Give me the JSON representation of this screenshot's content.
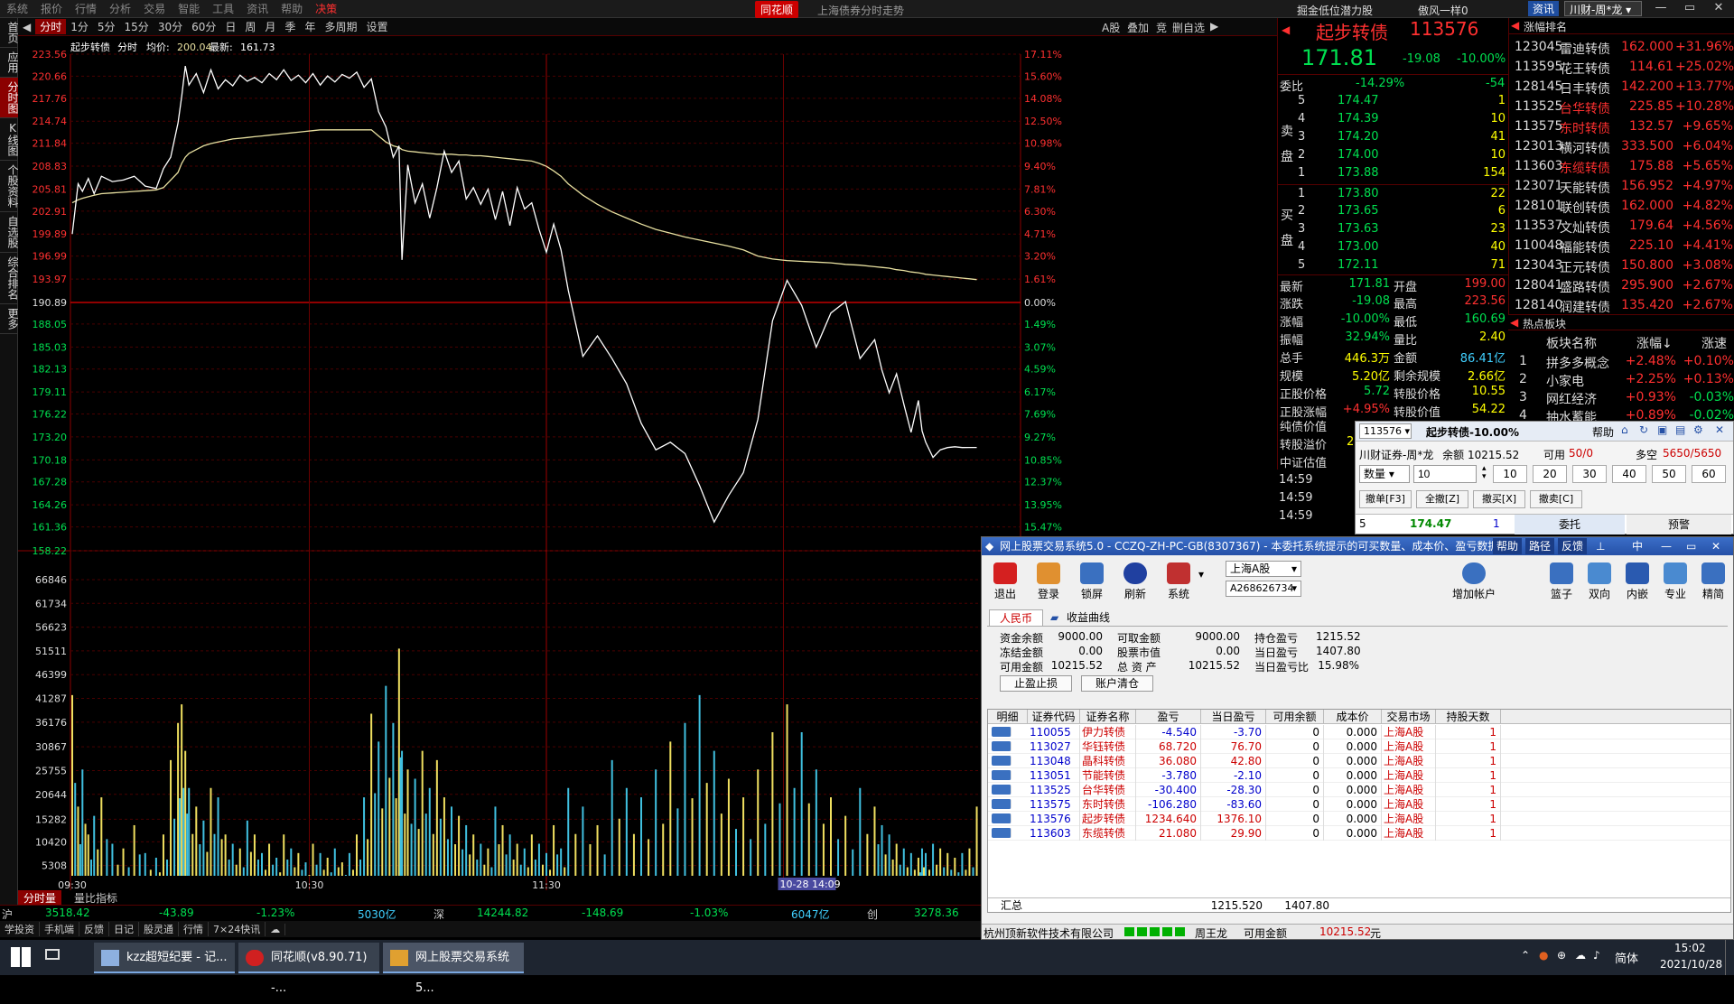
{
  "menu": {
    "items": [
      "系统",
      "报价",
      "行情",
      "分析",
      "交易",
      "智能",
      "工具",
      "资讯",
      "帮助",
      "决策"
    ],
    "logo": "同花顺",
    "window_title": "上海债券分时走势",
    "promo1": "掘金低位潜力股",
    "promo2": "傲风一样0",
    "news_btn": "资讯",
    "account_select": "川财-周*龙"
  },
  "leftbar": [
    "首页",
    "应用",
    "分时图",
    "K线图",
    "个股资料",
    "自选股",
    "综合排名",
    "更多"
  ],
  "toolbar": {
    "periods": [
      "分时",
      "1分",
      "5分",
      "15分",
      "30分",
      "60分",
      "日",
      "周",
      "月",
      "季",
      "年",
      "多周期",
      "设置"
    ],
    "right": [
      "A股",
      "叠加",
      "竞",
      "删自选"
    ]
  },
  "chart": {
    "header_name": "起步转债",
    "header_mode": "分时",
    "header_avg_label": "均价:",
    "header_avg": "200.04",
    "header_last_label": "最新:",
    "header_last": "161.73",
    "prev_close": "190.89",
    "price_ticks_up": [
      "223.56",
      "220.66",
      "217.76",
      "214.74",
      "211.84",
      "208.83",
      "205.81",
      "202.91",
      "199.89",
      "196.99",
      "193.97"
    ],
    "price_ticks_down": [
      "188.05",
      "185.03",
      "182.13",
      "179.11",
      "176.22",
      "173.20",
      "170.18",
      "167.28",
      "164.26",
      "161.36",
      "158.22"
    ],
    "pct_ticks_up": [
      "17.11%",
      "15.60%",
      "14.08%",
      "12.50%",
      "10.98%",
      "9.40%",
      "7.81%",
      "6.30%",
      "4.71%",
      "3.20%",
      "1.61%"
    ],
    "pct_zero": "0.00%",
    "pct_ticks_down": [
      "1.49%",
      "3.07%",
      "4.59%",
      "6.17%",
      "7.69%",
      "9.27%",
      "10.85%",
      "12.37%",
      "13.95%",
      "15.47%"
    ],
    "vol_ticks": [
      "66846",
      "61734",
      "56623",
      "51511",
      "46399",
      "41287",
      "36176",
      "30867",
      "25755",
      "20644",
      "15282",
      "10420",
      "5308"
    ],
    "time_labels": [
      "09:30",
      "10:30",
      "11:30"
    ],
    "date_label": "10-28 14:09",
    "tabs": [
      "分时量",
      "量比指标"
    ]
  },
  "index_bar": {
    "sh_label": "沪",
    "sh_value": "3518.42",
    "sh_change": "-43.89",
    "sh_pct": "-1.23%",
    "sh_amount": "5030亿",
    "sz_label": "深",
    "sz_value": "14244.82",
    "sz_change": "-148.69",
    "sz_pct": "-1.03%",
    "sz_amount": "6047亿",
    "cy_label": "创",
    "cy_value": "3278.36"
  },
  "quickbar": [
    "学投资",
    "手机端",
    "反馈",
    "日记",
    "股灵通",
    "行情",
    "7×24快讯"
  ],
  "quote": {
    "name": "起步转债",
    "code": "113576",
    "price": "171.81",
    "change": "-19.08",
    "pct": "-10.00%",
    "weibi_label": "委比",
    "weibi": "-14.29%",
    "weicha": "-54",
    "sell_label": "卖盘",
    "buy_label": "买盘",
    "asks": [
      {
        "lv": "5",
        "p": "174.47",
        "v": "1"
      },
      {
        "lv": "4",
        "p": "174.39",
        "v": "10"
      },
      {
        "lv": "3",
        "p": "174.20",
        "v": "41"
      },
      {
        "lv": "2",
        "p": "174.00",
        "v": "10"
      },
      {
        "lv": "1",
        "p": "173.88",
        "v": "154"
      }
    ],
    "bids": [
      {
        "lv": "1",
        "p": "173.80",
        "v": "22"
      },
      {
        "lv": "2",
        "p": "173.65",
        "v": "6"
      },
      {
        "lv": "3",
        "p": "173.63",
        "v": "23"
      },
      {
        "lv": "4",
        "p": "173.00",
        "v": "40"
      },
      {
        "lv": "5",
        "p": "172.11",
        "v": "71"
      }
    ],
    "stats": [
      {
        "l1": "最新",
        "v1": "171.81",
        "l2": "开盘",
        "v2": "199.00"
      },
      {
        "l1": "涨跌",
        "v1": "-19.08",
        "l2": "最高",
        "v2": "223.56"
      },
      {
        "l1": "涨幅",
        "v1": "-10.00%",
        "l2": "最低",
        "v2": "160.69"
      },
      {
        "l1": "振幅",
        "v1": "32.94%",
        "l2": "量比",
        "v2": "2.40"
      },
      {
        "l1": "总手",
        "v1": "446.3万",
        "l2": "金额",
        "v2": "86.41亿"
      },
      {
        "l1": "规模",
        "v1": "5.20亿",
        "l2": "剩余规模",
        "v2": "2.66亿"
      },
      {
        "l1": "正股价格",
        "v1": "5.72",
        "l2": "转股价格",
        "v2": "10.55"
      },
      {
        "l1": "正股涨幅",
        "v1": "+4.95%",
        "l2": "转股价值",
        "v2": "54.22"
      }
    ],
    "extra": [
      "纯债价值",
      "转股溢价",
      "中证估值"
    ],
    "extra_val": "2",
    "ticks": [
      "14:59",
      "14:59",
      "14:59"
    ]
  },
  "ranking": {
    "title": "涨幅排名",
    "rows": [
      {
        "code": "123045",
        "name": "雷迪转债",
        "price": "162.000",
        "pct": "+31.96%"
      },
      {
        "code": "113595",
        "name": "花王转债",
        "price": "114.61",
        "pct": "+25.02%"
      },
      {
        "code": "128145",
        "name": "日丰转债",
        "price": "142.200",
        "pct": "+13.77%"
      },
      {
        "code": "113525",
        "name": "台华转债",
        "price": "225.85",
        "pct": "+10.28%"
      },
      {
        "code": "113575",
        "name": "东时转债",
        "price": "132.57",
        "pct": "+9.65%"
      },
      {
        "code": "123013",
        "name": "横河转债",
        "price": "333.500",
        "pct": "+6.04%"
      },
      {
        "code": "113603",
        "name": "东缆转债",
        "price": "175.88",
        "pct": "+5.65%"
      },
      {
        "code": "123071",
        "name": "天能转债",
        "price": "156.952",
        "pct": "+4.97%"
      },
      {
        "code": "128101",
        "name": "联创转债",
        "price": "162.000",
        "pct": "+4.82%"
      },
      {
        "code": "113537",
        "name": "文灿转债",
        "price": "179.64",
        "pct": "+4.56%"
      },
      {
        "code": "110048",
        "name": "福能转债",
        "price": "225.10",
        "pct": "+4.41%"
      },
      {
        "code": "123043",
        "name": "正元转债",
        "price": "150.800",
        "pct": "+3.08%"
      },
      {
        "code": "128041",
        "name": "盛路转债",
        "price": "295.900",
        "pct": "+2.67%"
      },
      {
        "code": "128140",
        "name": "润建转债",
        "price": "135.420",
        "pct": "+2.67%"
      }
    ]
  },
  "board": {
    "title": "热点板块",
    "headers": [
      "板块名称",
      "涨幅↓",
      "涨速"
    ],
    "rows": [
      {
        "n": "1",
        "name": "拼多多概念",
        "pct": "+2.48%",
        "spd": "+0.10%"
      },
      {
        "n": "2",
        "name": "小家电",
        "pct": "+2.25%",
        "spd": "+0.13%"
      },
      {
        "n": "3",
        "name": "网红经济",
        "pct": "+0.93%",
        "spd": "-0.03%"
      },
      {
        "n": "4",
        "name": "抽水蓄能",
        "pct": "+0.89%",
        "spd": "-0.02%"
      }
    ]
  },
  "order": {
    "code": "113576",
    "title": "起步转债-10.00%",
    "help": "帮助",
    "account": "川财证券-周*龙",
    "balance_label": "余额",
    "balance": "10215.52",
    "avail_label": "可用",
    "avail": "50/0",
    "dk_label": "多空",
    "dk": "5650/5650",
    "qty_label": "数量",
    "qty_value": "10",
    "qty_btns": [
      "10",
      "20",
      "30",
      "40",
      "50",
      "60"
    ],
    "actions": [
      "撤单[F3]",
      "全撤[Z]",
      "撤买[X]",
      "撤卖[C]"
    ],
    "level": "5",
    "level_price": "174.47",
    "level_vol": "1",
    "tab1": "委托",
    "tab2": "预警"
  },
  "trade": {
    "title": "网上股票交易系统5.0 - CCZQ-ZH-PC-GB(8307367) - 本委托系统提示的可买数量、成本价、盈亏数据仅供参考",
    "title_btns": [
      "帮助",
      "路径",
      "反馈"
    ],
    "lang": "中",
    "toolbar": [
      "退出",
      "登录",
      "锁屏",
      "刷新",
      "系统"
    ],
    "market_select": "上海A股",
    "account_select": "A268626734",
    "add_account": "增加帐户",
    "right_tools": [
      "篮子",
      "双向",
      "内嵌",
      "专业",
      "精简"
    ],
    "tab_rmb": "人民币",
    "tab_curve": "收益曲线",
    "summary": [
      {
        "l": "资金余额",
        "v": "9000.00",
        "l2": "可取金额",
        "v2": "9000.00",
        "l3": "持仓盈亏",
        "v3": "1215.52"
      },
      {
        "l": "冻结金额",
        "v": "0.00",
        "l2": "股票市值",
        "v2": "0.00",
        "l3": "当日盈亏",
        "v3": "1407.80"
      },
      {
        "l": "可用金额",
        "v": "10215.52",
        "l2": "总 资 产",
        "v2": "10215.52",
        "l3": "当日盈亏比",
        "v3": "15.98%"
      }
    ],
    "btn_stop": "止盈止损",
    "btn_clear": "账户清仓",
    "columns": [
      "明细",
      "证券代码",
      "证券名称",
      "盈亏",
      "当日盈亏",
      "可用余额",
      "成本价",
      "交易市场",
      "持股天数"
    ],
    "rows": [
      {
        "code": "110055",
        "name": "伊力转债",
        "pl": "-4.540",
        "dpl": "-3.70",
        "avail": "0",
        "cost": "0.000",
        "mkt": "上海A股",
        "days": "1"
      },
      {
        "code": "113027",
        "name": "华钰转债",
        "pl": "68.720",
        "dpl": "76.70",
        "avail": "0",
        "cost": "0.000",
        "mkt": "上海A股",
        "days": "1"
      },
      {
        "code": "113048",
        "name": "晶科转债",
        "pl": "36.080",
        "dpl": "42.80",
        "avail": "0",
        "cost": "0.000",
        "mkt": "上海A股",
        "days": "1"
      },
      {
        "code": "113051",
        "name": "节能转债",
        "pl": "-3.780",
        "dpl": "-2.10",
        "avail": "0",
        "cost": "0.000",
        "mkt": "上海A股",
        "days": "1"
      },
      {
        "code": "113525",
        "name": "台华转债",
        "pl": "-30.400",
        "dpl": "-28.30",
        "avail": "0",
        "cost": "0.000",
        "mkt": "上海A股",
        "days": "1"
      },
      {
        "code": "113575",
        "name": "东时转债",
        "pl": "-106.280",
        "dpl": "-83.60",
        "avail": "0",
        "cost": "0.000",
        "mkt": "上海A股",
        "days": "1"
      },
      {
        "code": "113576",
        "name": "起步转债",
        "pl": "1234.640",
        "dpl": "1376.10",
        "avail": "0",
        "cost": "0.000",
        "mkt": "上海A股",
        "days": "1"
      },
      {
        "code": "113603",
        "name": "东缆转债",
        "pl": "21.080",
        "dpl": "29.90",
        "avail": "0",
        "cost": "0.000",
        "mkt": "上海A股",
        "days": "1"
      }
    ],
    "total_label": "汇总",
    "total_pl": "1215.520",
    "total_dpl": "1407.80",
    "status_company": "杭州顶新软件技术有限公司",
    "status_user": "周王龙",
    "status_avail_label": "可用金额",
    "status_avail": "10215.52",
    "status_unit": "元"
  },
  "taskbar": {
    "tasks": [
      "kzz超短纪要 - 记...",
      "同花顺(v8.90.71) -...",
      "网上股票交易系统5..."
    ],
    "lang": "简体",
    "time": "15:02",
    "date": "2021/10/28"
  },
  "colors": {
    "up": "#ff3030",
    "down": "#00e050",
    "price_line": "#ffffff",
    "avg_line": "#e8e0a0",
    "grid": "#6a0000"
  },
  "chart_data": {
    "type": "line",
    "title": "起步转债 分时",
    "prev_close": 190.89,
    "ylim": [
      158.22,
      223.56
    ],
    "price_x": [
      0,
      8,
      14,
      22,
      30,
      40,
      55,
      70,
      85,
      100,
      115,
      125,
      135,
      145,
      150,
      155,
      160,
      170,
      180,
      190,
      200,
      210,
      220,
      230,
      240,
      250,
      260,
      270,
      280,
      290,
      300,
      310,
      320,
      330,
      340,
      350,
      360,
      370,
      380,
      390,
      400,
      410,
      420,
      430,
      440,
      448,
      452,
      460,
      470,
      480,
      490,
      500,
      510,
      520,
      530,
      540,
      550,
      560,
      570,
      580,
      590,
      600,
      610,
      620,
      630,
      640,
      650,
      660,
      670,
      680,
      700,
      720,
      740,
      760,
      780,
      800,
      820,
      840,
      860,
      880,
      900,
      920,
      940,
      960,
      980,
      1000,
      1020,
      1040,
      1060,
      1080,
      1100,
      1110,
      1120,
      1130,
      1140,
      1150,
      1160,
      1165,
      1170,
      1180,
      1190,
      1200,
      1210,
      1220,
      1230,
      1240
    ],
    "price": [
      199.9,
      206.5,
      205.5,
      207.2,
      205.2,
      207.5,
      206.8,
      207.0,
      207.5,
      206.2,
      205.9,
      208.5,
      210.0,
      214.5,
      218.0,
      222.0,
      219.5,
      221.0,
      218.5,
      221.5,
      219.0,
      220.2,
      219.4,
      220.8,
      220.0,
      220.5,
      219.8,
      221.0,
      220.2,
      221.5,
      220.1,
      220.8,
      219.8,
      221.0,
      219.5,
      220.7,
      219.9,
      220.9,
      220.4,
      221.2,
      219.2,
      220.3,
      216.0,
      214.0,
      210.0,
      211.5,
      196.5,
      209.0,
      204.0,
      206.5,
      202.0,
      206.0,
      210.8,
      208.0,
      209.5,
      204.5,
      206.0,
      203.8,
      205.8,
      201.8,
      205.5,
      201.0,
      206.0,
      203.2,
      204.0,
      200.5,
      197.5,
      201.2,
      197.8,
      192.5,
      183.8,
      186.5,
      183.5,
      180.2,
      175.0,
      171.5,
      172.5,
      171.0,
      166.8,
      162.0,
      165.5,
      168.5,
      175.5,
      188.5,
      193.8,
      190.5,
      185.0,
      189.5,
      191.0,
      183.5,
      186.0,
      182.0,
      179.0,
      181.5,
      177.5,
      173.8,
      178.0,
      174.0,
      172.5,
      170.5,
      171.5,
      171.8,
      171.9,
      171.8,
      171.81,
      171.81
    ],
    "avg": [
      204.0,
      204.4,
      204.6,
      204.8,
      205.0,
      205.2,
      205.3,
      205.4,
      205.5,
      205.6,
      205.7,
      206.0,
      207.0,
      208.0,
      209.2,
      210.0,
      210.5,
      211.0,
      211.5,
      211.8,
      212.0,
      212.2,
      212.4,
      212.5,
      212.6,
      212.7,
      212.8,
      212.9,
      213.0,
      213.1,
      213.2,
      213.3,
      213.4,
      213.5,
      213.6,
      213.6,
      213.6,
      213.6,
      213.6,
      213.6,
      213.6,
      213.6,
      212.8,
      212.0,
      211.5,
      211.3,
      211.0,
      210.8,
      210.7,
      210.6,
      210.5,
      210.4,
      210.4,
      210.4,
      210.3,
      210.3,
      210.2,
      210.2,
      210.1,
      210.0,
      209.9,
      209.8,
      209.7,
      209.6,
      209.5,
      209.2,
      208.8,
      208.2,
      207.5,
      206.5,
      205.0,
      203.8,
      202.8,
      202.0,
      201.2,
      200.5,
      200.0,
      199.5,
      199.1,
      198.7,
      198.3,
      197.8,
      197.0,
      196.6,
      196.4,
      196.3,
      196.2,
      196.1,
      195.9,
      195.8,
      195.6,
      195.5,
      195.4,
      195.2,
      195.1,
      194.9,
      194.8,
      194.7,
      194.6,
      194.5,
      194.4,
      194.3,
      194.2,
      194.1,
      194.0,
      193.9
    ],
    "volume": [
      42000,
      18000,
      26000,
      12000,
      16000,
      20000,
      10000,
      9000,
      14000,
      8000,
      7000,
      12000,
      28000,
      36000,
      40000,
      30000,
      22000,
      18000,
      15000,
      22000,
      20000,
      12000,
      10000,
      9000,
      15000,
      12000,
      8000,
      10000,
      7000,
      12000,
      9000,
      8000,
      6000,
      10000,
      8000,
      7000,
      9000,
      6000,
      8000,
      12000,
      20000,
      38000,
      32000,
      44000,
      36000,
      52000,
      30000,
      26000,
      24000,
      30000,
      22000,
      28000,
      20000,
      18000,
      16000,
      14000,
      12000,
      10000,
      9000,
      18000,
      14000,
      12000,
      10000,
      9000,
      12000,
      10000,
      8000,
      14000,
      9000,
      22000,
      18000,
      14000,
      28000,
      22000,
      20000,
      26000,
      32000,
      36000,
      42000,
      30000,
      24000,
      20000,
      26000,
      34000,
      40000,
      34000,
      26000,
      20000,
      16000,
      22000,
      18000,
      14000,
      12000,
      10000,
      9000,
      8000,
      7000,
      9000,
      8000,
      10000,
      9000,
      8000,
      7000,
      8000,
      9000,
      18000
    ],
    "vol_ylim": [
      0,
      66846
    ],
    "x_labels": [
      "09:30",
      "10:30",
      "11:30"
    ]
  }
}
